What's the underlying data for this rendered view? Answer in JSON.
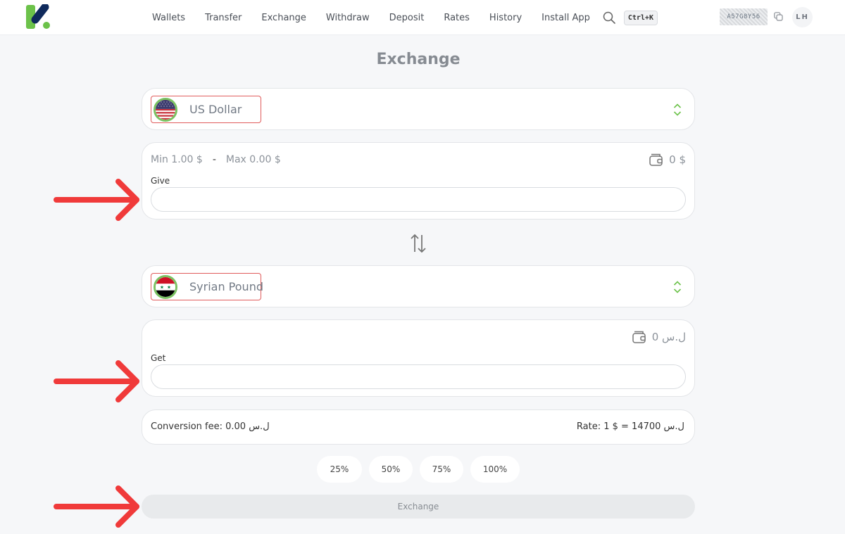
{
  "header": {
    "nav": [
      "Wallets",
      "Transfer",
      "Exchange",
      "Withdraw",
      "Deposit",
      "Rates",
      "History",
      "Install App"
    ],
    "search_shortcut": "Ctrl+K",
    "account_id": "A57G8Y56",
    "avatar_initials": "LH"
  },
  "page": {
    "title": "Exchange"
  },
  "from": {
    "currency": "US Dollar",
    "min_max_min": "Min 1.00 $",
    "min_max_sep": "-",
    "min_max_max": "Max 0.00 $",
    "balance": "0 $",
    "field_label": "Give",
    "value": "",
    "placeholder": ""
  },
  "to": {
    "currency": "Syrian Pound",
    "balance": "ل.س 0",
    "field_label": "Get",
    "value": "",
    "placeholder": ""
  },
  "info": {
    "fee": "Conversion fee: 0.00 ل.س",
    "rate": "Rate: 1 $ = 14700 ل.س"
  },
  "percent_buttons": [
    "25%",
    "50%",
    "75%",
    "100%"
  ],
  "submit_label": "Exchange",
  "colors": {
    "brand_green": "#6cc24a",
    "brand_navy": "#0f2a5c",
    "annotation_red": "#f03a3a"
  }
}
